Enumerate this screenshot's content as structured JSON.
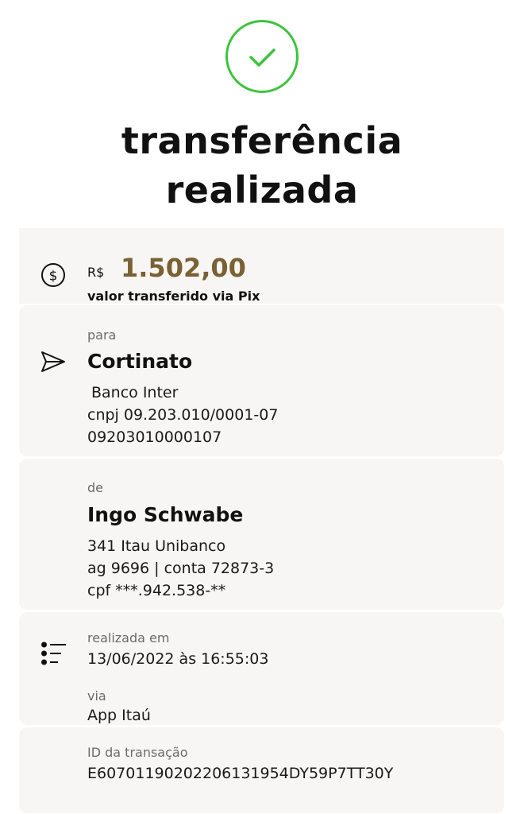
{
  "header": {
    "title_line1": "transferência",
    "title_line2": "realizada"
  },
  "amount": {
    "currency": "R$",
    "value": "1.502,00",
    "subtitle": "valor transferido via Pix"
  },
  "recipient": {
    "label": "para",
    "name": "Cortinato",
    "bank": "Banco Inter",
    "document": "cnpj 09.203.010/0001-07",
    "account": "09203010000107"
  },
  "sender": {
    "label": "de",
    "name": "Ingo Schwabe",
    "bank": "341 Itau Unibanco",
    "account": "ag 9696 | conta 72873-3",
    "document": "cpf ***.942.538-**"
  },
  "details": {
    "date_label": "realizada em",
    "date_value": "13/06/2022 às 16:55:03",
    "via_label": "via",
    "via_value": "App Itaú",
    "id_label": "ID da transação",
    "id_value": "E60701190202206131954DY59P7TT30Y"
  },
  "icons": {
    "success": "check-circle-icon",
    "amount": "dollar-circle-icon",
    "recipient": "send-icon",
    "details": "list-icon"
  },
  "colors": {
    "success_green": "#3cc43c",
    "amount_gold": "#7a6133",
    "card_bg": "#f7f6f4"
  }
}
